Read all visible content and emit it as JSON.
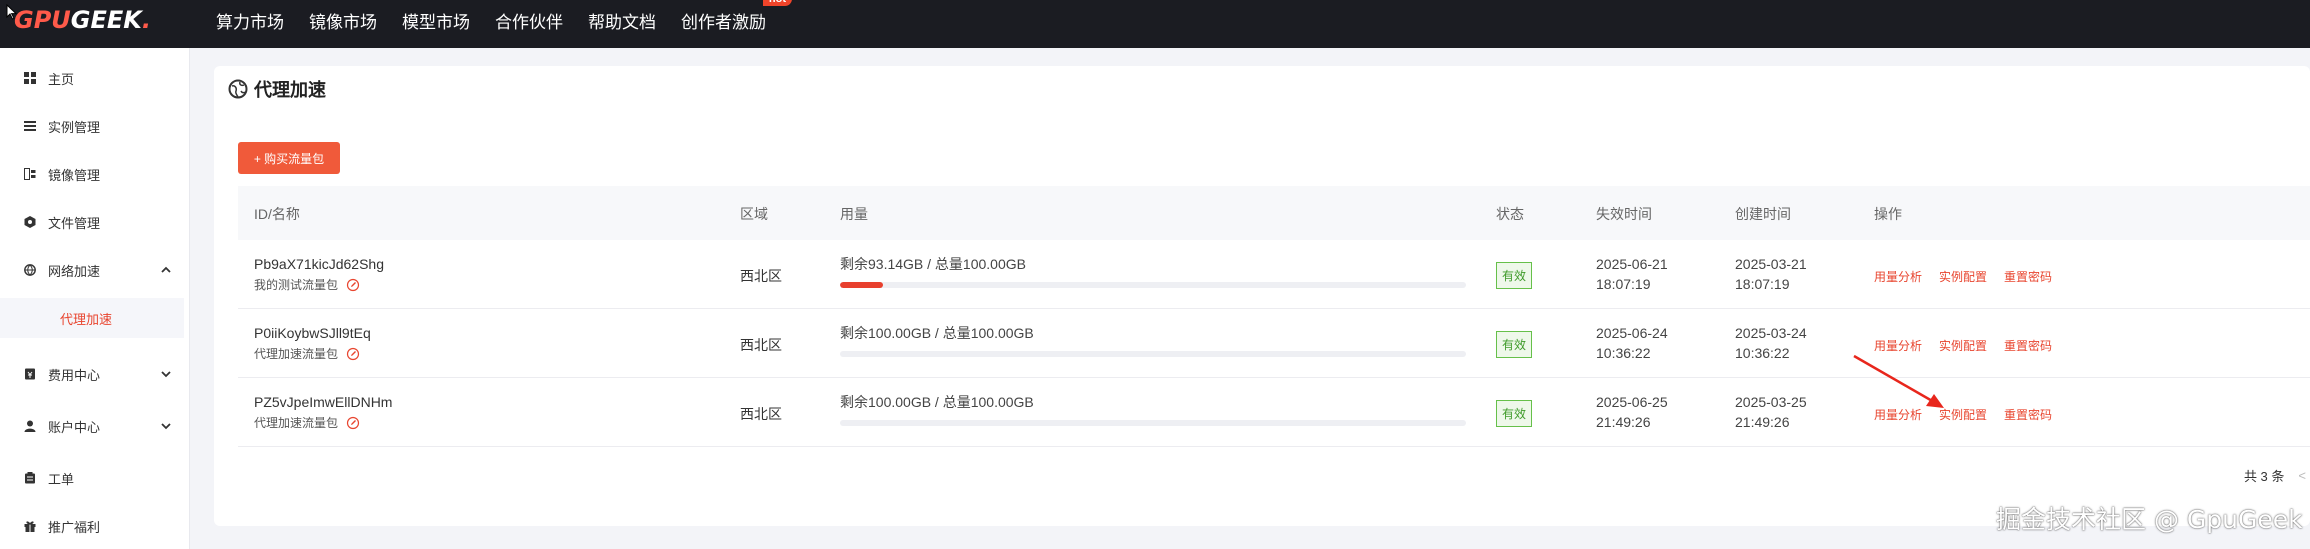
{
  "brand": {
    "logo_text_gpu": "GPU",
    "logo_text_geek": "GEEK",
    "logo_dot": "."
  },
  "nav": {
    "items": [
      {
        "label": "算力市场"
      },
      {
        "label": "镜像市场"
      },
      {
        "label": "模型市场"
      },
      {
        "label": "合作伙伴"
      },
      {
        "label": "帮助文档"
      },
      {
        "label": "创作者激励"
      }
    ],
    "hot_badge": "hot"
  },
  "sidebar": {
    "items": [
      {
        "label": "主页",
        "icon": "grid-icon"
      },
      {
        "label": "实例管理",
        "icon": "list-icon"
      },
      {
        "label": "镜像管理",
        "icon": "image-icon"
      },
      {
        "label": "文件管理",
        "icon": "folder-icon"
      },
      {
        "label": "网络加速",
        "icon": "globe-icon",
        "expanded": true
      },
      {
        "label": "代理加速",
        "active": true
      },
      {
        "label": "费用中心",
        "icon": "wallet-icon"
      },
      {
        "label": "账户中心",
        "icon": "user-icon"
      },
      {
        "label": "工单",
        "icon": "ticket-icon"
      },
      {
        "label": "推广福利",
        "icon": "gift-icon"
      }
    ]
  },
  "page": {
    "title": "代理加速",
    "buy_button": "+ 购买流量包"
  },
  "table": {
    "headers": {
      "id": "ID/名称",
      "region": "区域",
      "usage": "用量",
      "status": "状态",
      "expire": "失效时间",
      "created": "创建时间",
      "ops": "操作"
    },
    "rows": [
      {
        "id": "Pb9aX71kicJd62Shg",
        "name": "我的测试流量包",
        "region": "西北区",
        "usage_text": "剩余93.14GB / 总量100.00GB",
        "used_fraction": 0.0686,
        "status": "有效",
        "expire_date": "2025-06-21",
        "expire_time": "18:07:19",
        "created_date": "2025-03-21",
        "created_time": "18:07:19"
      },
      {
        "id": "P0iiKoybwSJll9tEq",
        "name": "代理加速流量包",
        "region": "西北区",
        "usage_text": "剩余100.00GB / 总量100.00GB",
        "used_fraction": 0,
        "status": "有效",
        "expire_date": "2025-06-24",
        "expire_time": "10:36:22",
        "created_date": "2025-03-24",
        "created_time": "10:36:22"
      },
      {
        "id": "PZ5vJpeImwEllDNHm",
        "name": "代理加速流量包",
        "region": "西北区",
        "usage_text": "剩余100.00GB / 总量100.00GB",
        "used_fraction": 0,
        "status": "有效",
        "expire_date": "2025-06-25",
        "expire_time": "21:49:26",
        "created_date": "2025-03-25",
        "created_time": "21:49:26"
      }
    ],
    "ops_labels": {
      "analysis": "用量分析",
      "config": "实例配置",
      "reset": "重置密码"
    }
  },
  "pagination": {
    "total": "共 3 条",
    "prev": "<"
  },
  "watermark": "掘金技术社区 @ GpuGeek",
  "colors": {
    "accent": "#e8452f",
    "topbar": "#1b1c22",
    "status_green": "#3f9b2a"
  }
}
